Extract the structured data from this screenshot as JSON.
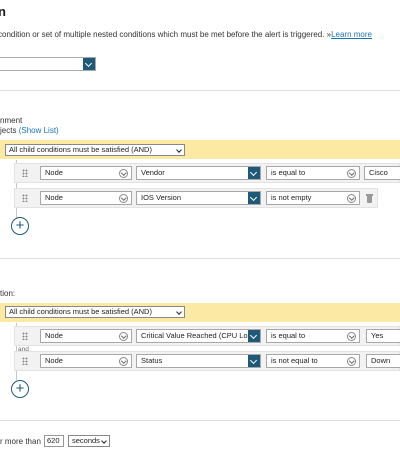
{
  "header": {
    "title": "n",
    "description": " condition or set of multiple nested conditions which must be met before the alert is triggered. »",
    "learn_more": "Learn more"
  },
  "top_select": {
    "value": ""
  },
  "scope": {
    "line1": "nment",
    "line2": "jects",
    "show_list": "(Show List)"
  },
  "group1": {
    "operator": "All child conditions must be satisfied (AND)",
    "rows": [
      {
        "object": "Node",
        "field": "Vendor",
        "comparator": "is equal to",
        "value": "Cisco"
      },
      {
        "object": "Node",
        "field": "IOS Version",
        "comparator": "is not empty",
        "value": ""
      }
    ]
  },
  "trigger_label": "tion:",
  "group2": {
    "operator": "All child conditions must be satisfied (AND)",
    "connector": "and",
    "rows": [
      {
        "object": "Node",
        "field": "Critical Value Reached (CPU Load)",
        "comparator": "is equal to",
        "value": "Yes"
      },
      {
        "object": "Node",
        "field": "Status",
        "comparator": "is not equal to",
        "value": "Down"
      }
    ]
  },
  "duration": {
    "prefix": "r more than",
    "amount": "620",
    "unit": "seconds"
  }
}
